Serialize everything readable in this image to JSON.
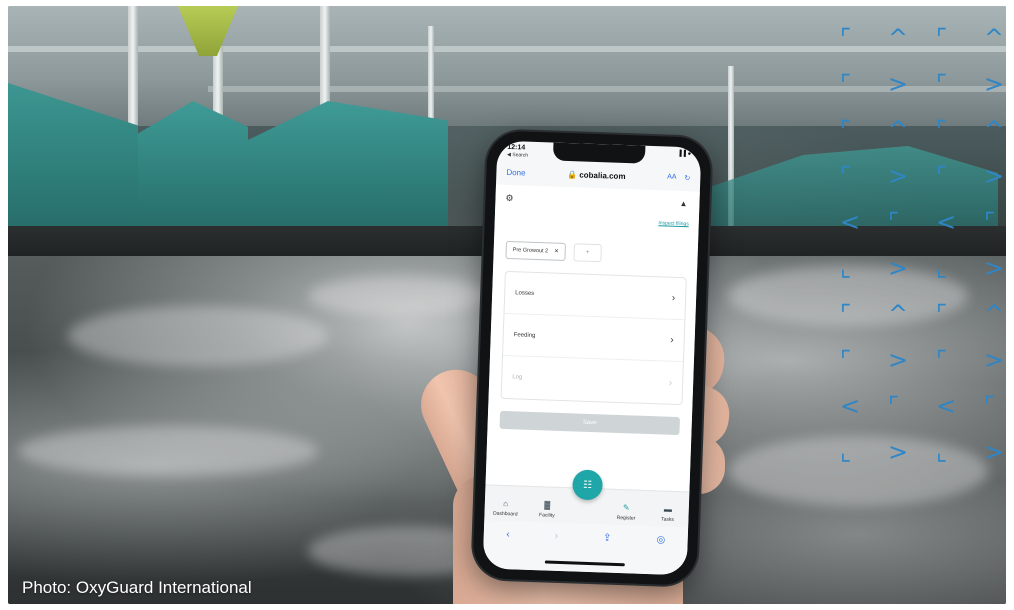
{
  "caption": "Photo: OxyGuard International",
  "phone": {
    "status_time": "12:14",
    "status_back": "◀ Search",
    "status_icons": "▐▐ ●",
    "url_done": "Done",
    "url_domain": "🔒 cobalia.com",
    "url_aa": "AA",
    "url_reload": "↻",
    "gear_icon": "⚙",
    "bell_icon": "▲",
    "inspect_link": "Inspect filings",
    "chip_label": "Pre Growout 2",
    "chip_close": "✕",
    "chip_plus": "+",
    "rows": [
      {
        "label": "Losses",
        "chev": "›"
      },
      {
        "label": "Feeding",
        "chev": "›"
      },
      {
        "label": "Log",
        "chev": "›"
      }
    ],
    "save_label": "Save",
    "tabs": [
      {
        "label": "Dashboard",
        "icon": "⌂"
      },
      {
        "label": "Facility",
        "icon": "▓"
      },
      {
        "label": "Register",
        "icon": "✎"
      },
      {
        "label": "Tasks",
        "icon": "▬"
      }
    ],
    "fab_icon": "☷",
    "safari": {
      "back": "‹",
      "forward": "›",
      "share": "⇪",
      "compass": "◎"
    }
  },
  "overlay_glyphs": {
    "color": "#2f86c6",
    "corner": "⌜",
    "corner_bl": "⌞",
    "caret_up": "^",
    "chev_right": ">",
    "chev_left": "<"
  }
}
